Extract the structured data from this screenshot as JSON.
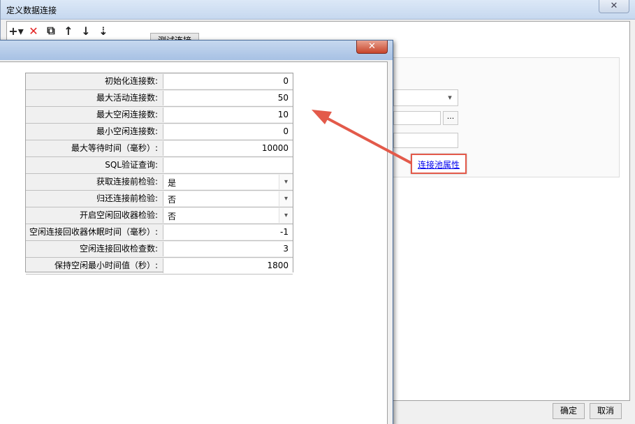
{
  "outer_dialog": {
    "title": "定义数据连接",
    "close_glyph": "✕",
    "test_button_label": "测试连接",
    "pool_link_label": "连接池属性",
    "ok_label": "确定",
    "cancel_label": "取消",
    "browse_label": "..."
  },
  "toolbar": {
    "add_glyph": "+▾",
    "delete_glyph": "✕",
    "copy_glyph": "⧉",
    "up_glyph": "↑",
    "down_glyph": "↓",
    "sort_glyph": "⇣"
  },
  "inner_dialog": {
    "close_glyph": "✕"
  },
  "properties": [
    {
      "label": "初始化连接数:",
      "value": "0",
      "type": "number"
    },
    {
      "label": "最大活动连接数:",
      "value": "50",
      "type": "number"
    },
    {
      "label": "最大空闲连接数:",
      "value": "10",
      "type": "number"
    },
    {
      "label": "最小空闲连接数:",
      "value": "0",
      "type": "number"
    },
    {
      "label": "最大等待时间（毫秒）:",
      "value": "10000",
      "type": "number"
    },
    {
      "label": "SQL验证查询:",
      "value": "",
      "type": "text"
    },
    {
      "label": "获取连接前检验:",
      "value": "是",
      "type": "select"
    },
    {
      "label": "归还连接前检验:",
      "value": "否",
      "type": "select"
    },
    {
      "label": "开启空闲回收器检验:",
      "value": "否",
      "type": "select"
    },
    {
      "label": "空闲连接回收器休眠时间（毫秒）:",
      "value": "-1",
      "type": "number"
    },
    {
      "label": "空闲连接回收检查数:",
      "value": "3",
      "type": "number"
    },
    {
      "label": "保持空闲最小时间值（秒）:",
      "value": "1800",
      "type": "number"
    }
  ],
  "colors": {
    "annotation": "#e35a4a",
    "link": "#0000ee",
    "delete_icon": "#e32222"
  }
}
